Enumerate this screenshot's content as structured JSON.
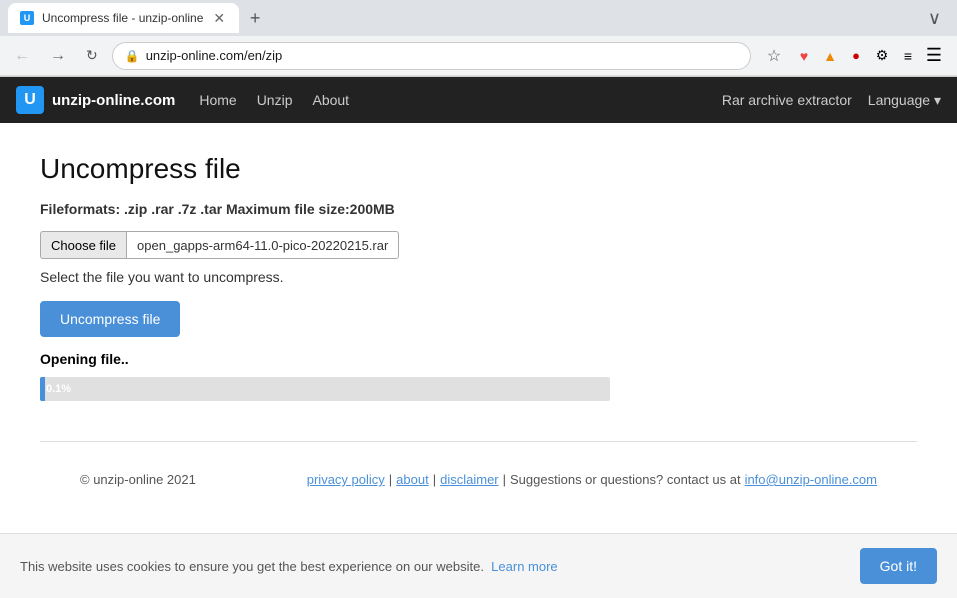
{
  "browser": {
    "tab_title": "Uncompress file - unzip-online",
    "new_tab_icon": "+",
    "address": "unzip-online.com/en/zip",
    "scroll_chevron": "∨"
  },
  "sitenav": {
    "logo_letter": "U",
    "site_name": "unzip-online.com",
    "nav_links": [
      {
        "label": "Home"
      },
      {
        "label": "Unzip"
      },
      {
        "label": "About"
      }
    ],
    "rar_link": "Rar archive extractor",
    "language_btn": "Language ▾"
  },
  "main": {
    "page_title": "Uncompress file",
    "fileformats_label": "Fileformats:",
    "fileformats_value": " .zip .rar .7z .tar ",
    "maxsize_label": "Maximum file size:",
    "maxsize_value": "200MB",
    "choose_file_label": "Choose file",
    "file_name": "open_gapps-arm64-11.0-pico-20220215.rar",
    "select_hint": "Select the file you want to uncompress.",
    "uncompress_btn": "Uncompress file",
    "opening_label": "Opening file..",
    "progress_percent": "0.1%",
    "progress_width": "0.8%"
  },
  "footer": {
    "copyright": "© unzip-online 2021",
    "privacy_policy": "privacy policy",
    "sep1": "|",
    "about": "about",
    "sep2": "|",
    "disclaimer": "disclaimer",
    "sep3": "|",
    "contact_text": "Suggestions or questions? contact us at",
    "email": "info@unzip-online.com"
  },
  "cookie": {
    "message": "This website uses cookies to ensure you get the best experience on our website.",
    "learn_more": "Learn more",
    "got_it": "Got it!"
  }
}
